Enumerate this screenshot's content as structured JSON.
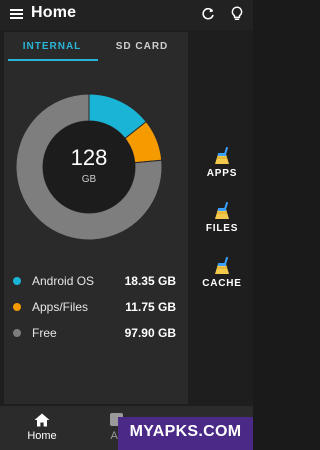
{
  "app": {
    "title": "Home"
  },
  "header": {
    "menu_icon": "menu-icon",
    "refresh_icon": "refresh-icon",
    "tip_icon": "lightbulb-icon"
  },
  "tabs": [
    {
      "label": "INTERNAL",
      "active": true
    },
    {
      "label": "SD CARD",
      "active": false
    }
  ],
  "storage": {
    "total_value": "128",
    "total_unit": "GB",
    "segments": [
      {
        "label": "Android OS",
        "value": "18.35 GB",
        "gb": 18.35,
        "color": "#1ab4d6"
      },
      {
        "label": "Apps/Files",
        "value": "11.75 GB",
        "gb": 11.75,
        "color": "#f59b00"
      },
      {
        "label": "Free",
        "value": "97.90 GB",
        "gb": 97.9,
        "color": "#7e7e7e"
      }
    ]
  },
  "side_actions": [
    {
      "label": "APPS",
      "icon": "broom-icon"
    },
    {
      "label": "FILES",
      "icon": "broom-icon"
    },
    {
      "label": "CACHE",
      "icon": "broom-icon"
    }
  ],
  "bottom_nav": {
    "home_label": "Home",
    "apps_label": "Ar"
  },
  "watermark": {
    "text": "MYAPKS.COM"
  },
  "colors": {
    "accent": "#29b6d6",
    "background": "#1e1e1e",
    "card": "#2a2a2a"
  }
}
